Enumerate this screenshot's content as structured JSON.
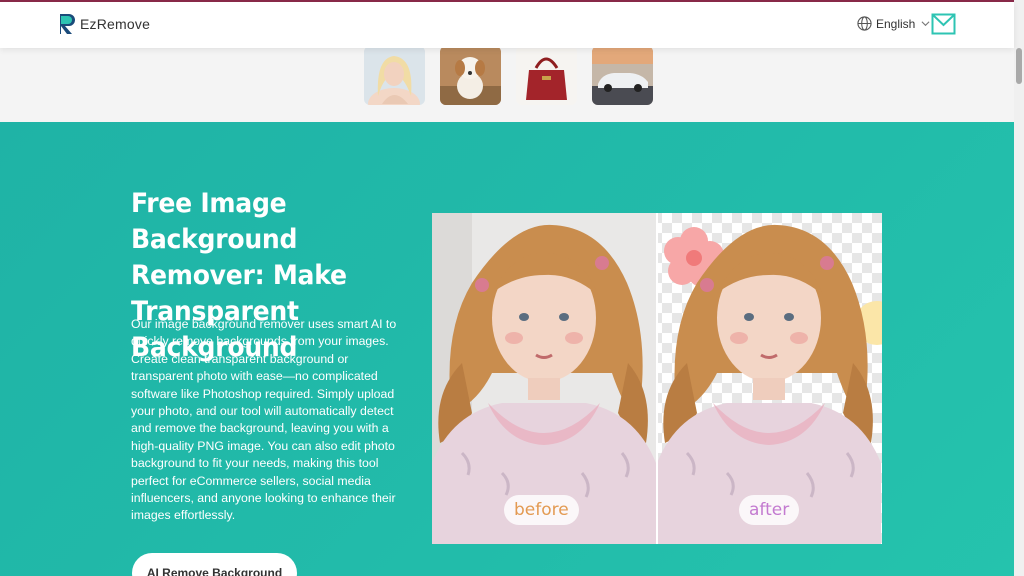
{
  "header": {
    "logo_letter": "R",
    "logo_text": "EzRemove",
    "language": "English"
  },
  "hero": {
    "title": "Free Image Background Remover: Make Transparent Background",
    "description": "Our image background remover uses smart AI to quickly remove backgrounds from your images. Create clean transparent background or transparent photo with ease—no complicated software like Photoshop required. Simply upload your photo, and our tool will automatically detect and remove the background, leaving you with a high-quality PNG image. You can also edit photo background to fit your needs, making this tool perfect for eCommerce sellers, social media influencers, and anyone looking to enhance their images effortlessly.",
    "cta_label": "AI Remove Background",
    "before_label": "before",
    "after_label": "after"
  },
  "colors": {
    "accent": "#22bcaa",
    "brand_dark": "#1b4b7a"
  }
}
